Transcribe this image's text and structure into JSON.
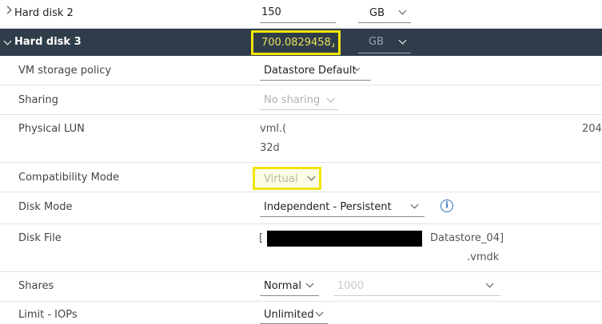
{
  "hard_disk_2": {
    "label": "Hard disk 2",
    "size": "150",
    "unit": "GB"
  },
  "hard_disk_3": {
    "label": "Hard disk 3",
    "size": "700.0829458⸥",
    "unit": "GB"
  },
  "rows": {
    "storage_policy": {
      "label": "VM storage policy",
      "value": "Datastore Default"
    },
    "sharing": {
      "label": "Sharing",
      "value": "No sharing"
    },
    "physical_lun": {
      "label": "Physical LUN",
      "line1": "vml.(",
      "line2": "32d",
      "right": "204"
    },
    "compat_mode": {
      "label": "Compatibility Mode",
      "value": "Virtual"
    },
    "disk_mode": {
      "label": "Disk Mode",
      "value": "Independent - Persistent"
    },
    "disk_file": {
      "label": "Disk File",
      "prefix": "[",
      "datastore": "Datastore_04]",
      "ext": ".vmdk"
    },
    "shares": {
      "label": "Shares",
      "value": "Normal",
      "amount": "1000"
    },
    "limit_iops": {
      "label": "Limit - IOPs",
      "value": "Unlimited"
    }
  },
  "colors": {
    "header_bg": "#2f3d4a",
    "highlight": "#f2e600",
    "info_blue": "#2a6ebb"
  }
}
